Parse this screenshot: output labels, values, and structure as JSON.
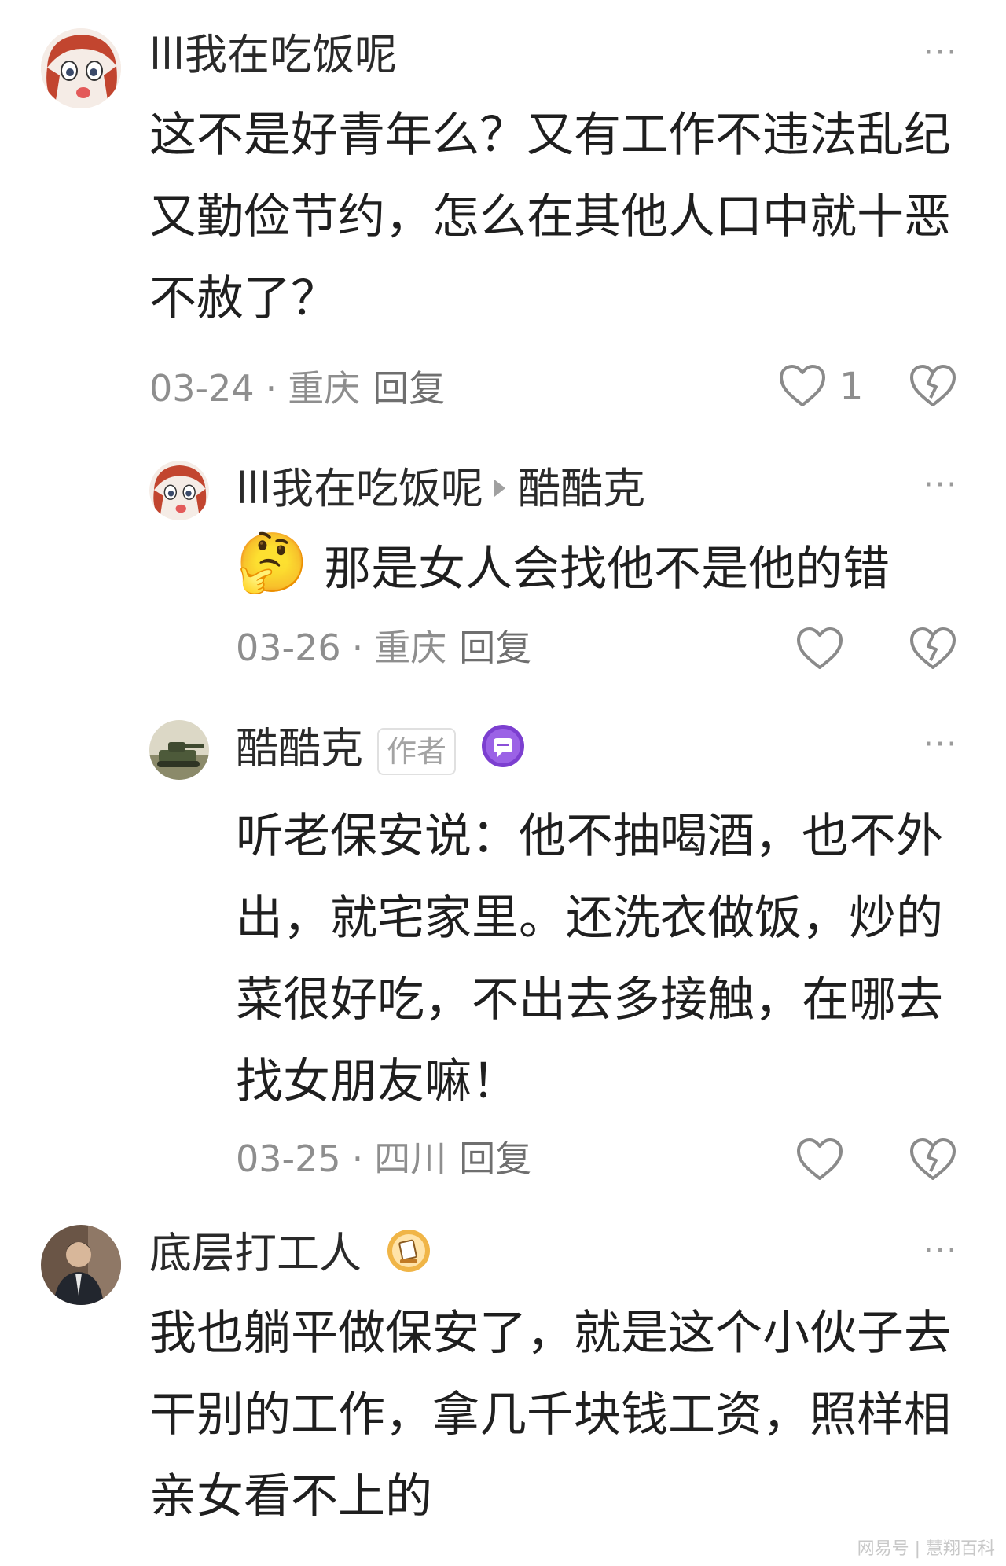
{
  "comments": [
    {
      "username": "lll我在吃饭呢",
      "text": "这不是好青年么？又有工作不违法乱纪又勤俭节约，怎么在其他人口中就十恶不赦了？",
      "date": "03-24",
      "location": "重庆",
      "reply_label": "回复",
      "like_count": "1"
    },
    {
      "username": "lll我在吃饭呢",
      "reply_to": "酷酷克",
      "emoji": "🤔",
      "text": "那是女人会找他不是他的错",
      "date": "03-26",
      "location": "重庆",
      "reply_label": "回复"
    },
    {
      "username": "酷酷克",
      "badge": "作者",
      "text": "听老保安说：他不抽喝酒，也不外出，就宅家里。还洗衣做饭，炒的菜很好吃，不出去多接触，在哪去找女朋友嘛！",
      "date": "03-25",
      "location": "四川",
      "reply_label": "回复"
    },
    {
      "username": "底层打工人",
      "text": "我也躺平做保安了，就是这个小伙子去干别的工作，拿几千块钱工资，照样相亲女看不上的"
    }
  ],
  "separator": "·",
  "more_label": "···",
  "watermark": "网易号 | 慧翔百科",
  "colors": {
    "text": "#1f1f1f",
    "meta": "#8e8e8e",
    "icon": "#8a8a8a",
    "badge_purple": "#8a4fd8"
  }
}
